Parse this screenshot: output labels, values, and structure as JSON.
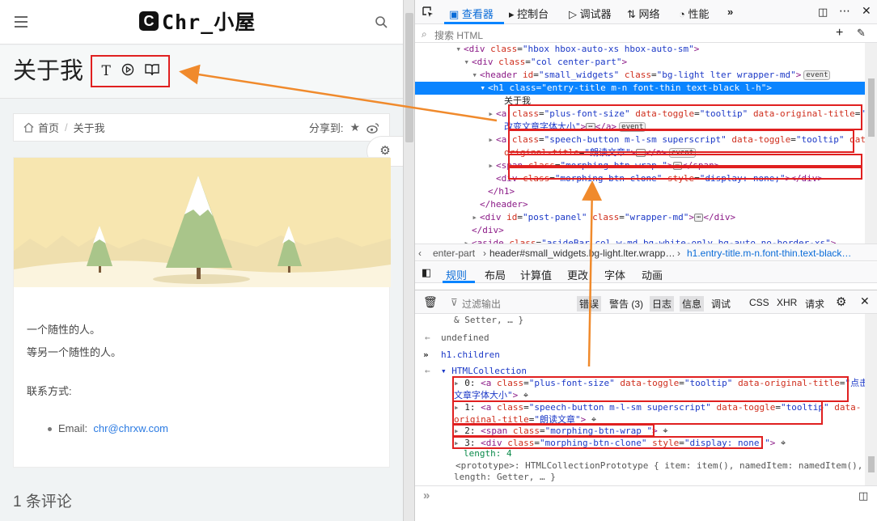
{
  "site": {
    "logo_letter": "C",
    "logo_text": "Chr_小屋",
    "page_title": "关于我",
    "title_buttons": [
      "T",
      "⏵",
      "📖"
    ],
    "breadcrumb": {
      "home": "首页",
      "current": "关于我"
    },
    "share_label": "分享到:",
    "post_lines": [
      "一个随性的人。",
      "等另一个随性的人。"
    ],
    "contact_label": "联系方式:",
    "email_label": "Email:",
    "email": "chr@chrxw.com",
    "comments": "1 条评论"
  },
  "devtools": {
    "tabs": [
      "查看器",
      "控制台",
      "调试器",
      "网络",
      "性能"
    ],
    "search_placeholder": "搜索 HTML",
    "tree": [
      {
        "i": 0,
        "parts": [
          [
            "tag",
            "<div "
          ],
          [
            "attr",
            "class"
          ],
          [
            "plain",
            "="
          ],
          [
            "aval",
            "\"hbox hbox-auto-xs hbox-auto-sm\""
          ],
          [
            "tag",
            ">"
          ]
        ]
      },
      {
        "i": 1,
        "parts": [
          [
            "tag",
            "<div "
          ],
          [
            "attr",
            "class"
          ],
          [
            "plain",
            "="
          ],
          [
            "aval",
            "\"col center-part\""
          ],
          [
            "tag",
            ">"
          ]
        ]
      },
      {
        "i": 2,
        "parts": [
          [
            "tag",
            "<header "
          ],
          [
            "attr",
            "id"
          ],
          [
            "plain",
            "="
          ],
          [
            "aval",
            "\"small_widgets\" "
          ],
          [
            "attr",
            "class"
          ],
          [
            "plain",
            "="
          ],
          [
            "aval",
            "\"bg-light lter wrapper-md\""
          ],
          [
            "tag",
            ">"
          ]
        ],
        "event": true
      },
      {
        "i": 3,
        "parts": [
          [
            "tag",
            "<h1 "
          ],
          [
            "attr",
            "class"
          ],
          [
            "plain",
            "="
          ],
          [
            "aval",
            "\"entry-title m-n font-thin text-black l-h\""
          ],
          [
            "tag",
            ">"
          ]
        ],
        "hl": true
      },
      {
        "i": 4,
        "parts": [
          [
            "plain",
            "关于我"
          ]
        ]
      },
      {
        "i": 5,
        "parts": [
          [
            "tag",
            "<a "
          ],
          [
            "attr",
            "class"
          ],
          [
            "plain",
            "="
          ],
          [
            "aval",
            "\"plus-font-size\" "
          ],
          [
            "attr",
            "data-toggle"
          ],
          [
            "plain",
            "="
          ],
          [
            "aval",
            "\"tooltip\" "
          ],
          [
            "attr",
            "data-original-title"
          ],
          [
            "plain",
            "="
          ],
          [
            "aval",
            "\"点击"
          ]
        ]
      },
      {
        "i": 6,
        "parts": [
          [
            "aval",
            "改变文章字体大小\""
          ],
          [
            "tag",
            ">"
          ]
        ],
        "dots": true,
        "close": "</a>",
        "event": true
      },
      {
        "i": 7,
        "parts": [
          [
            "tag",
            "<a "
          ],
          [
            "attr",
            "class"
          ],
          [
            "plain",
            "="
          ],
          [
            "aval",
            "\"speech-button m-l-sm superscript\" "
          ],
          [
            "attr",
            "data-toggle"
          ],
          [
            "plain",
            "="
          ],
          [
            "aval",
            "\"tooltip\" "
          ],
          [
            "attr",
            "data-"
          ]
        ]
      },
      {
        "i": 8,
        "parts": [
          [
            "attr",
            "original-title"
          ],
          [
            "plain",
            "="
          ],
          [
            "aval",
            "\"朗读文章\""
          ],
          [
            "tag",
            ">"
          ]
        ],
        "dots": true,
        "close": "</a>",
        "event": true
      },
      {
        "i": 9,
        "parts": [
          [
            "tag",
            "<span "
          ],
          [
            "attr",
            "class"
          ],
          [
            "plain",
            "="
          ],
          [
            "aval",
            "\"morphing-btn-wrap \""
          ],
          [
            "tag",
            ">"
          ]
        ],
        "dots": true,
        "close": "</span>"
      },
      {
        "i": 10,
        "parts": [
          [
            "tag",
            "<div "
          ],
          [
            "attr",
            "class"
          ],
          [
            "plain",
            "="
          ],
          [
            "aval",
            "\"morphing-btn-clone\" "
          ],
          [
            "attr",
            "style"
          ],
          [
            "plain",
            "="
          ],
          [
            "aval",
            "\"display: none;\""
          ],
          [
            "tag",
            "></div>"
          ]
        ]
      },
      {
        "i": 11,
        "parts": [
          [
            "tag",
            "</h1>"
          ]
        ]
      },
      {
        "i": 12,
        "parts": [
          [
            "tag",
            "</header>"
          ]
        ]
      },
      {
        "i": 13,
        "parts": [
          [
            "tag",
            "<div "
          ],
          [
            "attr",
            "id"
          ],
          [
            "plain",
            "="
          ],
          [
            "aval",
            "\"post-panel\" "
          ],
          [
            "attr",
            "class"
          ],
          [
            "plain",
            "="
          ],
          [
            "aval",
            "\"wrapper-md\""
          ],
          [
            "tag",
            ">"
          ]
        ],
        "dots": true,
        "close": "</div>"
      },
      {
        "i": 14,
        "parts": [
          [
            "tag",
            "</div>"
          ]
        ]
      },
      {
        "i": 15,
        "parts": [
          [
            "tag",
            "<aside "
          ],
          [
            "attr",
            "class"
          ],
          [
            "plain",
            "="
          ],
          [
            "aval",
            "\"asideBar col w-md bg-white-only bg-auto no-border-xs\""
          ],
          [
            "tag",
            ">"
          ]
        ]
      }
    ],
    "breadcrumbs": [
      "enter-part",
      "header#small_widgets.bg-light.lter.wrapp…",
      "h1.entry-title.m-n.font-thin.text-black…"
    ],
    "rule_tabs": [
      "规则",
      "布局",
      "计算值",
      "更改",
      "字体",
      "动画"
    ],
    "filter_placeholder": "过滤输出",
    "console_filters": [
      "错误",
      "警告 (3)",
      "日志",
      "信息",
      "调试"
    ],
    "console_types": [
      "CSS",
      "XHR",
      "请求"
    ],
    "console": {
      "line0": "& Setter, … }",
      "undefined": "undefined",
      "input": "h1.children",
      "collection": "HTMLCollection",
      "items": [
        {
          "idx": "0:",
          "parts": [
            [
              "tag",
              "<a "
            ],
            [
              "attr",
              "class"
            ],
            [
              "plain",
              "="
            ],
            [
              "aval",
              "\"plus-font-size\" "
            ],
            [
              "attr",
              "data-toggle"
            ],
            [
              "plain",
              "="
            ],
            [
              "aval",
              "\"tooltip\" "
            ],
            [
              "attr",
              "data-original-title"
            ],
            [
              "plain",
              "="
            ],
            [
              "aval",
              "\"点击改变"
            ]
          ],
          "cont": [
            [
              "aval",
              "文章字体大小\""
            ],
            [
              "tag",
              ">"
            ]
          ]
        },
        {
          "idx": "1:",
          "parts": [
            [
              "tag",
              "<a "
            ],
            [
              "attr",
              "class"
            ],
            [
              "plain",
              "="
            ],
            [
              "aval",
              "\"speech-button m-l-sm superscript\" "
            ],
            [
              "attr",
              "data-toggle"
            ],
            [
              "plain",
              "="
            ],
            [
              "aval",
              "\"tooltip\" "
            ],
            [
              "attr",
              "data-"
            ]
          ],
          "cont": [
            [
              "attr",
              "original-title"
            ],
            [
              "plain",
              "="
            ],
            [
              "aval",
              "\"朗读文章\""
            ],
            [
              "tag",
              ">"
            ]
          ]
        },
        {
          "idx": "2:",
          "parts": [
            [
              "tag",
              "<span "
            ],
            [
              "attr",
              "class"
            ],
            [
              "plain",
              "="
            ],
            [
              "aval",
              "\"morphing-btn-wrap \""
            ],
            [
              "tag",
              ">"
            ]
          ]
        },
        {
          "idx": "3:",
          "parts": [
            [
              "tag",
              "<div "
            ],
            [
              "attr",
              "class"
            ],
            [
              "plain",
              "="
            ],
            [
              "aval",
              "\"morphing-btn-clone\" "
            ],
            [
              "attr",
              "style"
            ],
            [
              "plain",
              "="
            ],
            [
              "aval",
              "\"display: none;\""
            ],
            [
              "tag",
              ">"
            ]
          ]
        }
      ],
      "length": "length: 4",
      "prototype": "<prototype>: HTMLCollectionPrototype { item: item(), namedItem: namedItem(),",
      "prototype2": "length: Getter, … }"
    }
  },
  "colors": {
    "annotation_box": "#e02020",
    "arrow": "#f08a2c",
    "selected": "#0a84ff"
  }
}
